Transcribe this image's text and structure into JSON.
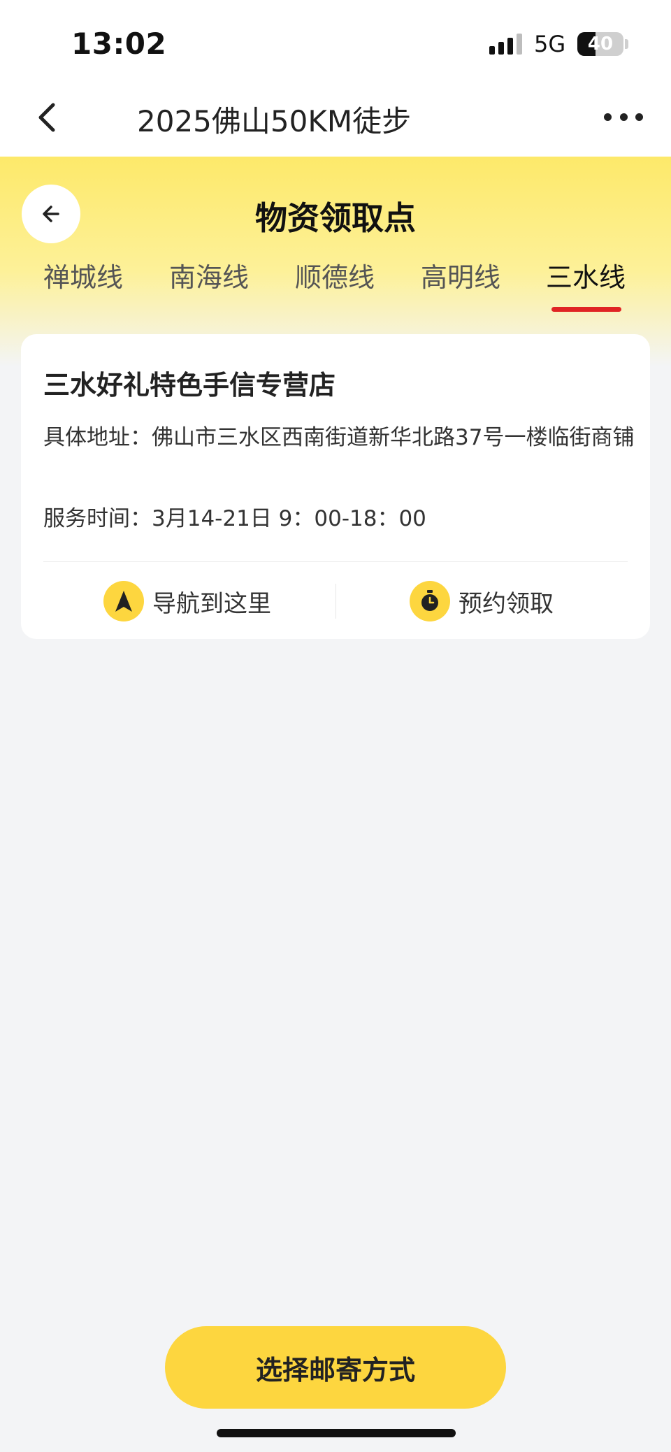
{
  "status_bar": {
    "time": "13:02",
    "network": "5G",
    "battery_level": "40",
    "battery_fraction": 0.4
  },
  "nav": {
    "title": "2025佛山50KM徒步",
    "back_icon": "chevron-left-icon",
    "more_icon": "more-horizontal-icon"
  },
  "header": {
    "title": "物资领取点",
    "back_icon": "arrow-left-icon"
  },
  "tabs": [
    {
      "label": "禅城线",
      "active": false
    },
    {
      "label": "南海线",
      "active": false
    },
    {
      "label": "顺德线",
      "active": false
    },
    {
      "label": "高明线",
      "active": false
    },
    {
      "label": "三水线",
      "active": true
    }
  ],
  "card": {
    "name": "三水好礼特色手信专营店",
    "address_label": "具体地址：",
    "address_value": "佛山市三水区西南街道新华北路37号一楼临街商铺",
    "hours_label": "服务时间：",
    "hours_value": "3月14-21日 9：00-18：00",
    "actions": [
      {
        "label": "导航到这里",
        "icon": "navigation-arrow-icon"
      },
      {
        "label": "预约领取",
        "icon": "timer-icon"
      }
    ]
  },
  "bottom_button": {
    "label": "选择邮寄方式"
  },
  "colors": {
    "accent_yellow": "#fdd63f",
    "header_yellow": "#fde96a",
    "tab_indicator": "#e02424",
    "background": "#f3f4f6"
  }
}
